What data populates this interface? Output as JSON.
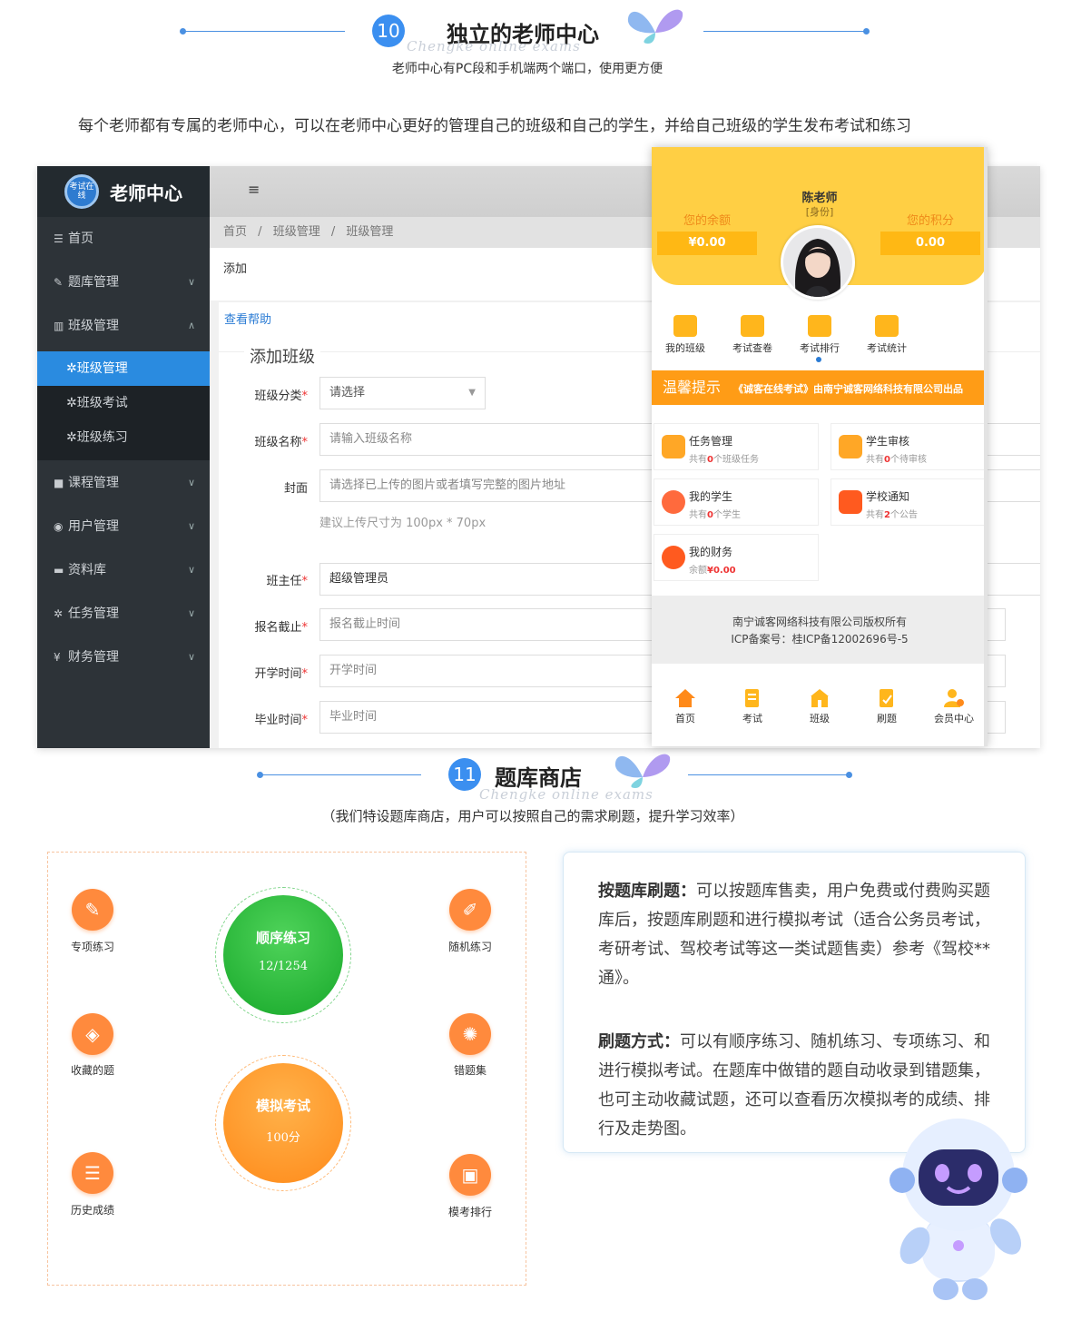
{
  "section10": {
    "number": "10",
    "title": "独立的老师中心",
    "watermark": "Chengke online exams",
    "subtitle": "老师中心有PC段和手机端两个端口，使用更方便",
    "description": "每个老师都有专属的老师中心，可以在老师中心更好的管理自己的班级和自己的学生，并给自己班级的学生发布考试和练习"
  },
  "admin": {
    "logo_text": "考试在线",
    "title": "老师中心",
    "menu_toggle": "≡",
    "sidebar": {
      "home": "首页",
      "question_bank": "题库管理",
      "class_mgmt": "班级管理",
      "sub_class_mgmt": "班级管理",
      "sub_class_exam": "班级考试",
      "sub_class_practice": "班级练习",
      "course_mgmt": "课程管理",
      "user_mgmt": "用户管理",
      "resource_lib": "资料库",
      "task_mgmt": "任务管理",
      "finance_mgmt": "财务管理"
    },
    "breadcrumb": {
      "home": "首页",
      "sep": "/",
      "level1": "班级管理",
      "level2": "班级管理"
    },
    "add_label": "添加",
    "help_link": "查看帮助",
    "form_title": "添加班级",
    "fields": {
      "category_label": "班级分类",
      "category_value": "请选择",
      "name_label": "班级名称",
      "name_placeholder": "请输入班级名称",
      "cover_label": "封面",
      "cover_placeholder": "请选择已上传的图片或者填写完整的图片地址",
      "cover_hint": "建议上传尺寸为 100px * 70px",
      "teacher_label": "班主任",
      "teacher_value": "超级管理员",
      "deadline_label": "报名截止",
      "deadline_placeholder": "报名截止时间",
      "start_label": "开学时间",
      "start_placeholder": "开学时间",
      "grad_label": "毕业时间",
      "grad_placeholder": "毕业时间"
    },
    "required_mark": "*"
  },
  "mobile": {
    "teacher_name": "陈老师",
    "role": "[身份]",
    "balance_label": "您的余额",
    "balance_value": "¥0.00",
    "points_label": "您的积分",
    "points_value": "0.00",
    "icons": [
      "我的班级",
      "考试查卷",
      "考试排行",
      "考试统计"
    ],
    "tip_title": "温馨提示",
    "tip_text": "《诚客在线考试》由南宁诚客网络科技有限公司出品",
    "cards": {
      "task_title": "任务管理",
      "task_pre": "共有",
      "task_num": "0",
      "task_post": "个班级任务",
      "review_title": "学生审核",
      "review_pre": "共有",
      "review_num": "0",
      "review_post": "个待审核",
      "student_title": "我的学生",
      "student_pre": "共有",
      "student_num": "0",
      "student_post": "个学生",
      "notice_title": "学校通知",
      "notice_pre": "共有",
      "notice_num": "2",
      "notice_post": "个公告",
      "finance_title": "我的财务",
      "finance_pre": "余额",
      "finance_num": "¥0.00"
    },
    "footer_line1": "南宁诚客网络科技有限公司版权所有",
    "footer_line2": "ICP备案号：桂ICP备12002696号-5",
    "nav": [
      "首页",
      "考试",
      "班级",
      "刷题",
      "会员中心"
    ]
  },
  "section11": {
    "number": "11",
    "title": "题库商店",
    "watermark": "Chengke online exams",
    "subtitle": "（我们特设题库商店，用户可以按照自己的需求刷题，提升学习效率）"
  },
  "store": {
    "left_icons": [
      "专项练习",
      "收藏的题",
      "历史成绩"
    ],
    "right_icons": [
      "随机练习",
      "错题集",
      "模考排行"
    ],
    "seq_title": "顺序练习",
    "seq_value": "12/1254",
    "mock_title": "模拟考试",
    "mock_value": "100分",
    "p1_head": "按题库刷题：",
    "p1_body": "可以按题库售卖，用户免费或付费购买题库后，按题库刷题和进行模拟考试（适合公务员考试，考研考试、驾校考试等这一类试题售卖）参考《驾校**通》。",
    "p2_head": "刷题方式：",
    "p2_body": "可以有顺序练习、随机练习、专项练习、和进行模拟考试。在题库中做错的题自动收录到错题集，也可主动收藏试题，还可以查看历次模拟考的成绩、排行及走势图。"
  },
  "colors": {
    "accent_blue": "#3b8ff0",
    "sidebar_bg": "#2d3338",
    "sidebar_active": "#2a8be0",
    "mobile_yellow": "#ffcf44",
    "tip_orange": "#ff9c16",
    "store_orange": "#ff8a3d",
    "seq_green": "#2fbf3c",
    "mock_orange": "#ff9a2a"
  }
}
